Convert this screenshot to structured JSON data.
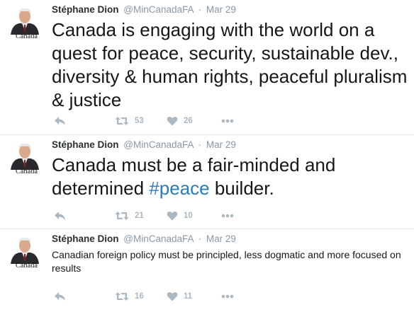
{
  "tweets": [
    {
      "author_name": "Stéphane Dion",
      "handle": "@MinCanadaFA",
      "separator": "·",
      "date": "Mar 29",
      "avatar_wordmark": "Canadä",
      "text": "Canada is engaging with the world on a quest for peace, security, sustainable dev., diversity & human rights, peaceful pluralism & justice",
      "retweets": "53",
      "likes": "26"
    },
    {
      "author_name": "Stéphane Dion",
      "handle": "@MinCanadaFA",
      "separator": "·",
      "date": "Mar 29",
      "avatar_wordmark": "Canadä",
      "text_before": "Canada must be a fair-minded and determined ",
      "hashtag": "#peace",
      "text_after": " builder.",
      "retweets": "21",
      "likes": "10"
    },
    {
      "author_name": "Stéphane Dion",
      "handle": "@MinCanadaFA",
      "separator": "·",
      "date": "Mar 29",
      "avatar_wordmark": "Canadä",
      "text": "Canadian foreign policy must be principled, less dogmatic and more focused on results",
      "retweets": "16",
      "likes": "11"
    }
  ],
  "icons": {
    "reply": "reply-icon",
    "retweet": "retweet-icon",
    "like": "heart-icon",
    "more": "more-icon"
  },
  "colors": {
    "text": "#14171a",
    "meta": "#8899a6",
    "icon": "#aab8c2",
    "hashtag": "#2b7bb9",
    "divider": "#e1e8ed"
  }
}
